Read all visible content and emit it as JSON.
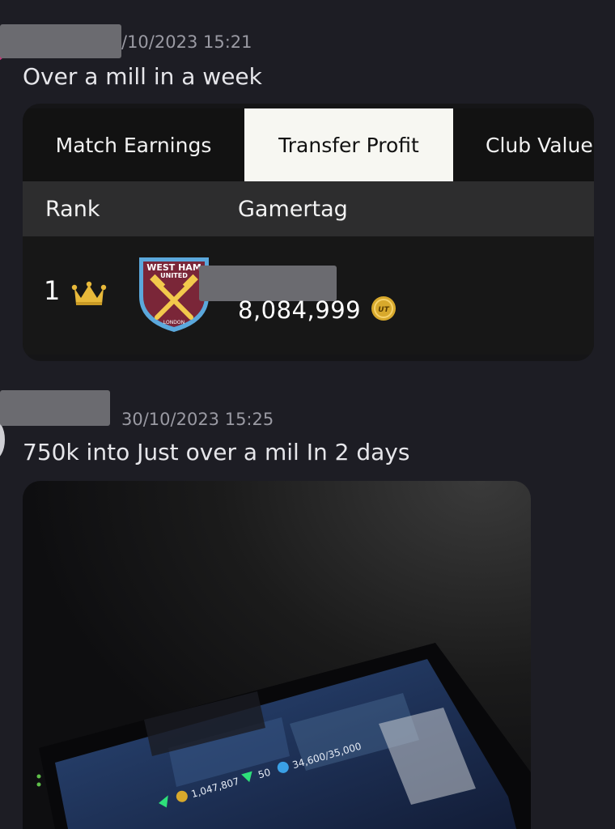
{
  "message1": {
    "timestamp": "/10/2023 15:21",
    "text": "Over a mill in a week"
  },
  "leaderboard": {
    "tabs": [
      "Match Earnings",
      "Transfer Profit",
      "Club Value"
    ],
    "active_tab": "Transfer Profit",
    "columns": [
      "Rank",
      "Gamertag"
    ],
    "rows": [
      {
        "rank": "1",
        "club_badge": "West Ham United crest",
        "badge_text": [
          "WEST HAM",
          "UNITED",
          "LONDON"
        ],
        "value": "8,084,999",
        "currency_icon": "ut-coin-icon"
      }
    ]
  },
  "message2": {
    "timestamp": "30/10/2023 15:25",
    "text": "750k into Just over a mil In 2 days"
  },
  "photo": {
    "coins": "1,047,807",
    "points": "50",
    "xp": "34,600/35,000"
  },
  "colors": {
    "background": "#1d1d24",
    "active_tab": "#f7f7f2",
    "crown": "#e8b93a",
    "coin": "#d8a92c",
    "crest_claret": "#7a2638",
    "crest_blue": "#5ba8dc"
  }
}
